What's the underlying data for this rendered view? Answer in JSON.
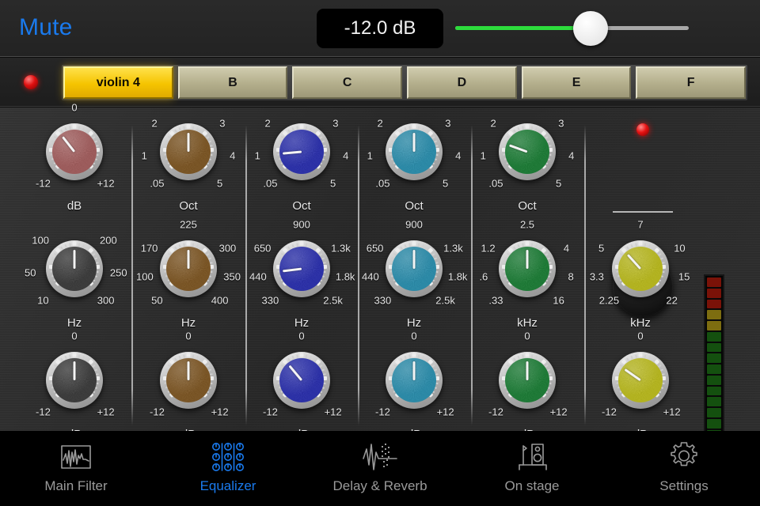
{
  "topbar": {
    "mute_label": "Mute",
    "db_value": "-12.0 dB",
    "slider_percent": 58,
    "slider_fill_color": "#2ddc3c",
    "slider_track_color": "#a8a8a8",
    "mute_color": "#1a7aed"
  },
  "presets": {
    "rec_led": "red-led",
    "items": [
      {
        "label": "violin 4",
        "active": true
      },
      {
        "label": "B",
        "active": false
      },
      {
        "label": "C",
        "active": false
      },
      {
        "label": "D",
        "active": false
      },
      {
        "label": "E",
        "active": false
      },
      {
        "label": "F",
        "active": false
      }
    ]
  },
  "channels": [
    {
      "name": "channel-1",
      "color": "#9e5b5b",
      "rows": [
        {
          "caption": "dB",
          "labels": [
            "-12",
            "0",
            "+12"
          ],
          "label_pos": [
            -135,
            0,
            135
          ],
          "angle": -38
        }
      ],
      "freq": {
        "caption": "Hz",
        "labels": [
          "10",
          "50",
          "100",
          "200",
          "250",
          "300"
        ],
        "label_pos": [
          -135,
          -95,
          -50,
          50,
          95,
          135
        ],
        "angle": 0,
        "color": "#3a3a3a"
      },
      "gain": {
        "caption": "dB",
        "labels": [
          "-12",
          "0",
          "+12"
        ],
        "label_pos": [
          -135,
          0,
          135
        ],
        "angle": 0,
        "color": "#3a3a3a"
      }
    },
    {
      "name": "channel-2",
      "color": "#7a5423",
      "bandwidth": {
        "caption": "Oct",
        "labels": [
          ".05",
          "1",
          "2",
          "3",
          "4",
          "5"
        ],
        "label_pos": [
          -135,
          -95,
          -50,
          50,
          95,
          135
        ],
        "angle": 0
      },
      "freq": {
        "caption": "Hz",
        "labels": [
          "50",
          "100",
          "170",
          "225",
          "300",
          "350",
          "400"
        ],
        "label_pos": [
          -135,
          -100,
          -62,
          0,
          62,
          100,
          135
        ],
        "angle": 0
      },
      "gain": {
        "caption": "dB",
        "labels": [
          "-12",
          "0",
          "+12"
        ],
        "label_pos": [
          -135,
          0,
          135
        ],
        "angle": 0
      }
    },
    {
      "name": "channel-3",
      "color": "#2a2fa8",
      "bandwidth": {
        "caption": "Oct",
        "labels": [
          ".05",
          "1",
          "2",
          "3",
          "4",
          "5"
        ],
        "label_pos": [
          -135,
          -95,
          -50,
          50,
          95,
          135
        ],
        "angle": -95
      },
      "freq": {
        "caption": "Hz",
        "labels": [
          "330",
          "440",
          "650",
          "900",
          "1.3k",
          "1.8k",
          "2.5k"
        ],
        "label_pos": [
          -135,
          -100,
          -62,
          0,
          62,
          100,
          135
        ],
        "angle": -97
      },
      "gain": {
        "caption": "dB",
        "labels": [
          "-12",
          "0",
          "+12"
        ],
        "label_pos": [
          -135,
          0,
          135
        ],
        "angle": -40
      }
    },
    {
      "name": "channel-4",
      "color": "#2a8aa8",
      "bandwidth": {
        "caption": "Oct",
        "labels": [
          ".05",
          "1",
          "2",
          "3",
          "4",
          "5"
        ],
        "label_pos": [
          -135,
          -95,
          -50,
          50,
          95,
          135
        ],
        "angle": 0
      },
      "freq": {
        "caption": "Hz",
        "labels": [
          "330",
          "440",
          "650",
          "900",
          "1.3k",
          "1.8k",
          "2.5k"
        ],
        "label_pos": [
          -135,
          -100,
          -62,
          0,
          62,
          100,
          135
        ],
        "angle": 0
      },
      "gain": {
        "caption": "dB",
        "labels": [
          "-12",
          "0",
          "+12"
        ],
        "label_pos": [
          -135,
          0,
          135
        ],
        "angle": 0
      }
    },
    {
      "name": "channel-5",
      "color": "#1c7a35",
      "bandwidth": {
        "caption": "Oct",
        "labels": [
          ".05",
          "1",
          "2",
          "3",
          "4",
          "5"
        ],
        "label_pos": [
          -135,
          -95,
          -50,
          50,
          95,
          135
        ],
        "angle": -70
      },
      "freq": {
        "caption": "kHz",
        "labels": [
          ".33",
          ".6",
          "1.2",
          "2.5",
          "4",
          "8",
          "16"
        ],
        "label_pos": [
          -135,
          -100,
          -62,
          0,
          62,
          100,
          135
        ],
        "angle": 0
      },
      "gain": {
        "caption": "dB",
        "labels": [
          "-12",
          "0",
          "+12"
        ],
        "label_pos": [
          -135,
          0,
          135
        ],
        "angle": 0
      }
    },
    {
      "name": "channel-6",
      "color": "#b5b51e",
      "freq": {
        "caption": "kHz",
        "labels": [
          "2.25",
          "3.3",
          "5",
          "7",
          "10",
          "15",
          "22"
        ],
        "label_pos": [
          -135,
          -100,
          -62,
          0,
          62,
          100,
          135
        ],
        "angle": -42
      },
      "gain": {
        "caption": "dB",
        "labels": [
          "-12",
          "0",
          "+12"
        ],
        "label_pos": [
          -135,
          0,
          135
        ],
        "angle": -55
      }
    }
  ],
  "black_knob": {
    "name": "bypass-knob",
    "led": "red-led"
  },
  "meter": {
    "name": "level-meter",
    "segments": [
      "#7a1208",
      "#7a1208",
      "#7a1208",
      "#7d6d10",
      "#7d6d10",
      "#14500f",
      "#14500f",
      "#14500f",
      "#14500f",
      "#14500f",
      "#14500f",
      "#14500f",
      "#14500f",
      "#14500f",
      "#14500f",
      "#14500f",
      "#26ef26",
      "#26ef26"
    ]
  },
  "tabs": [
    {
      "label": "Main Filter",
      "icon": "waveform-box-icon",
      "active": false
    },
    {
      "label": "Equalizer",
      "icon": "knob-grid-icon",
      "active": true
    },
    {
      "label": "Delay & Reverb",
      "icon": "delay-wave-icon",
      "active": false
    },
    {
      "label": "On stage",
      "icon": "stage-speaker-icon",
      "active": false
    },
    {
      "label": "Settings",
      "icon": "gear-icon",
      "active": false
    }
  ]
}
